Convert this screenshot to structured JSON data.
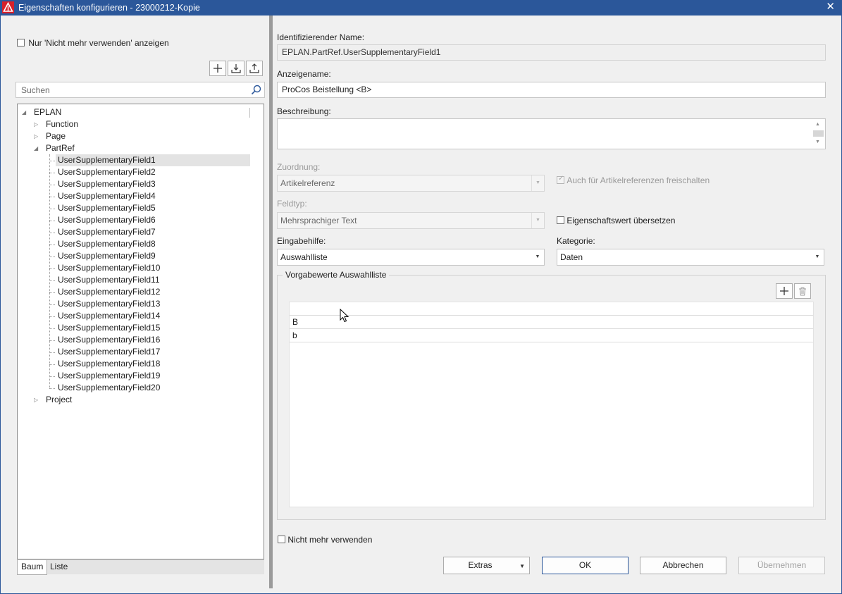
{
  "window": {
    "title": "Eigenschaften konfigurieren - 23000212-Kopie",
    "close_glyph": "✕"
  },
  "left": {
    "filter_label": "Nur 'Nicht mehr verwenden' anzeigen",
    "search_placeholder": "Suchen",
    "tree": {
      "root": "EPLAN",
      "groups": [
        "Function",
        "Page",
        "PartRef",
        "Project"
      ],
      "partref_children": [
        "UserSupplementaryField1",
        "UserSupplementaryField2",
        "UserSupplementaryField3",
        "UserSupplementaryField4",
        "UserSupplementaryField5",
        "UserSupplementaryField6",
        "UserSupplementaryField7",
        "UserSupplementaryField8",
        "UserSupplementaryField9",
        "UserSupplementaryField10",
        "UserSupplementaryField11",
        "UserSupplementaryField12",
        "UserSupplementaryField13",
        "UserSupplementaryField14",
        "UserSupplementaryField15",
        "UserSupplementaryField16",
        "UserSupplementaryField17",
        "UserSupplementaryField18",
        "UserSupplementaryField19",
        "UserSupplementaryField20"
      ],
      "selected": "UserSupplementaryField1"
    },
    "tabs": [
      "Baum",
      "Liste"
    ]
  },
  "right": {
    "ident_label": "Identifizierender Name:",
    "ident_value": "EPLAN.PartRef.UserSupplementaryField1",
    "display_label": "Anzeigename:",
    "display_value": "ProCos Beistellung <B>",
    "desc_label": "Beschreibung:",
    "desc_value": "",
    "assign_label": "Zuordnung:",
    "assign_value": "Artikelreferenz",
    "assign_check_label": "Auch für Artikelreferenzen freischalten",
    "fieldtype_label": "Feldtyp:",
    "fieldtype_value": "Mehrsprachiger Text",
    "translate_label": "Eigenschaftswert übersetzen",
    "input_aid_label": "Eingabehilfe:",
    "input_aid_value": "Auswahlliste",
    "category_label": "Kategorie:",
    "category_value": "Daten",
    "defaults_title": "Vorgabewerte Auswahlliste",
    "defaults_rows": [
      "",
      "B",
      "b"
    ],
    "obsolete_label": "Nicht mehr verwenden"
  },
  "buttons": {
    "extras": "Extras",
    "ok": "OK",
    "cancel": "Abbrechen",
    "apply": "Übernehmen"
  },
  "colors": {
    "titlebar": "#2b579a",
    "background": "#f0f0f0",
    "selection": "#e3e3e3"
  }
}
